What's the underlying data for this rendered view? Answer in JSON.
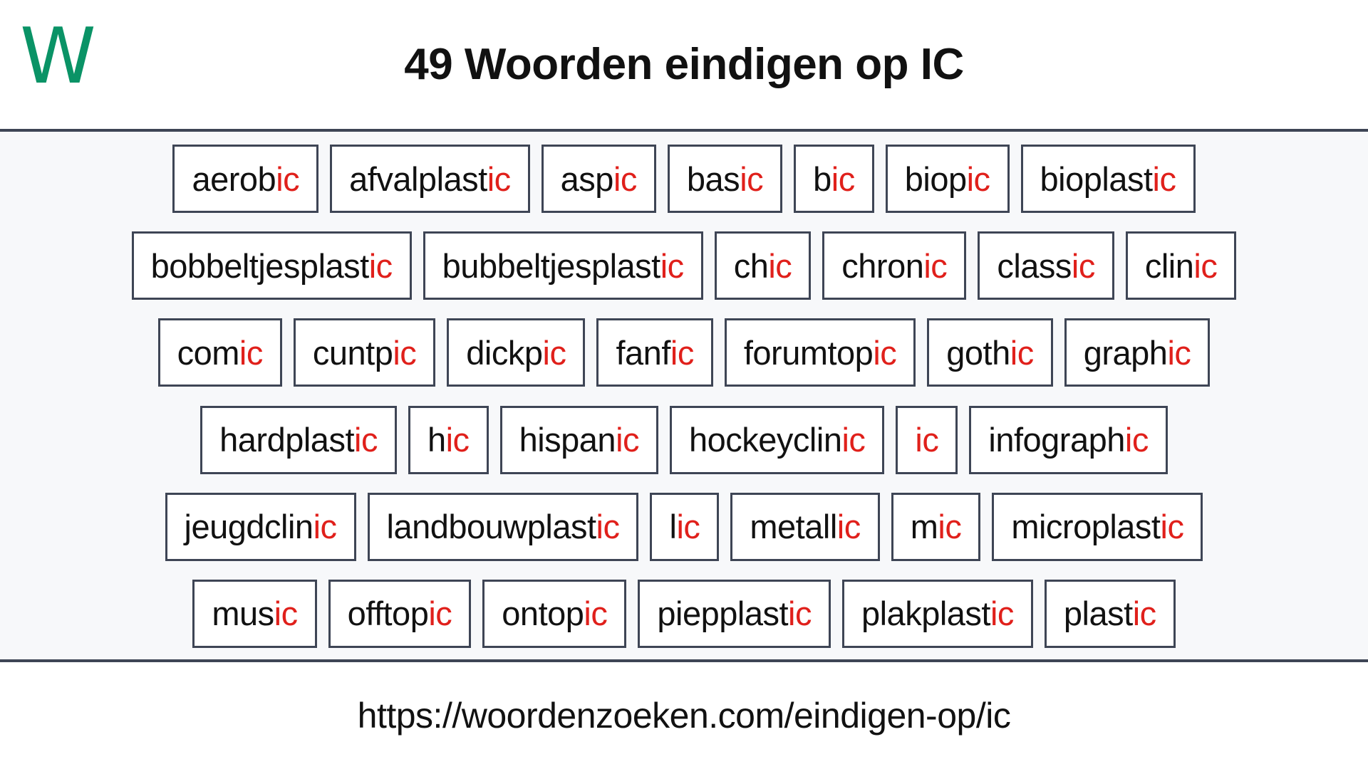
{
  "header": {
    "logo_text": "W",
    "logo_color": "#0a9366",
    "title": "49 Woorden eindigen op IC"
  },
  "theme": {
    "border_color": "#3e4555",
    "suffix_color": "#e0201b",
    "text_color": "#111111",
    "panel_background": "#f7f8fa",
    "box_background": "#ffffff"
  },
  "word_list": {
    "suffix": "ic",
    "total_count": 49,
    "rows": [
      [
        {
          "prefix": "aerob",
          "suffix": "ic"
        },
        {
          "prefix": "afvalplast",
          "suffix": "ic"
        },
        {
          "prefix": "asp",
          "suffix": "ic"
        },
        {
          "prefix": "bas",
          "suffix": "ic"
        },
        {
          "prefix": "b",
          "suffix": "ic"
        },
        {
          "prefix": "biop",
          "suffix": "ic"
        },
        {
          "prefix": "bioplast",
          "suffix": "ic"
        }
      ],
      [
        {
          "prefix": "bobbeltjesplast",
          "suffix": "ic"
        },
        {
          "prefix": "bubbeltjesplast",
          "suffix": "ic"
        },
        {
          "prefix": "ch",
          "suffix": "ic"
        },
        {
          "prefix": "chron",
          "suffix": "ic"
        },
        {
          "prefix": "class",
          "suffix": "ic"
        },
        {
          "prefix": "clin",
          "suffix": "ic"
        }
      ],
      [
        {
          "prefix": "com",
          "suffix": "ic"
        },
        {
          "prefix": "cuntp",
          "suffix": "ic"
        },
        {
          "prefix": "dickp",
          "suffix": "ic"
        },
        {
          "prefix": "fanf",
          "suffix": "ic"
        },
        {
          "prefix": "forumtop",
          "suffix": "ic"
        },
        {
          "prefix": "goth",
          "suffix": "ic"
        },
        {
          "prefix": "graph",
          "suffix": "ic"
        }
      ],
      [
        {
          "prefix": "hardplast",
          "suffix": "ic"
        },
        {
          "prefix": "h",
          "suffix": "ic"
        },
        {
          "prefix": "hispan",
          "suffix": "ic"
        },
        {
          "prefix": "hockeyclin",
          "suffix": "ic"
        },
        {
          "prefix": "",
          "suffix": "ic"
        },
        {
          "prefix": "infograph",
          "suffix": "ic"
        }
      ],
      [
        {
          "prefix": "jeugdclin",
          "suffix": "ic"
        },
        {
          "prefix": "landbouwplast",
          "suffix": "ic"
        },
        {
          "prefix": "l",
          "suffix": "ic"
        },
        {
          "prefix": "metall",
          "suffix": "ic"
        },
        {
          "prefix": "m",
          "suffix": "ic"
        },
        {
          "prefix": "microplast",
          "suffix": "ic"
        }
      ],
      [
        {
          "prefix": "mus",
          "suffix": "ic"
        },
        {
          "prefix": "offtop",
          "suffix": "ic"
        },
        {
          "prefix": "ontop",
          "suffix": "ic"
        },
        {
          "prefix": "piepplast",
          "suffix": "ic"
        },
        {
          "prefix": "plakplast",
          "suffix": "ic"
        },
        {
          "prefix": "plast",
          "suffix": "ic"
        }
      ]
    ]
  },
  "footer": {
    "url": "https://woordenzoeken.com/eindigen-op/ic"
  }
}
